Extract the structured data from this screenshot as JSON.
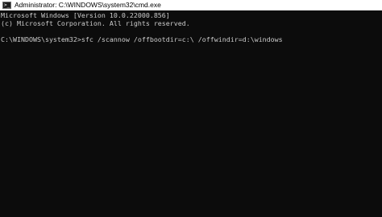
{
  "window": {
    "title": "Administrator: C:\\WINDOWS\\system32\\cmd.exe",
    "icon": "cmd-icon",
    "icon_glyph": ">_"
  },
  "console": {
    "lines": [
      "Microsoft Windows [Version 10.0.22000.856]",
      "(c) Microsoft Corporation. All rights reserved.",
      "",
      "C:\\WINDOWS\\system32>sfc /scannow /offbootdir=c:\\ /offwindir=d:\\windows"
    ]
  },
  "colors": {
    "background": "#0c0c0c",
    "text": "#cccccc",
    "titlebar": "#ffffff"
  }
}
